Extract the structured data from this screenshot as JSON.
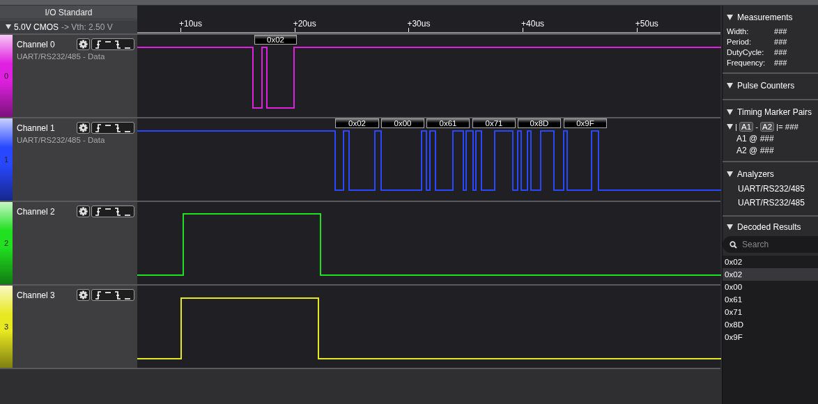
{
  "io_standard": {
    "title": "I/O Standard",
    "value": "5.0V CMOS",
    "threshold": "-> Vth: 2.50 V"
  },
  "timeline": {
    "ticks": [
      "+10us",
      "+20us",
      "+30us",
      "+40us",
      "+50us"
    ]
  },
  "channels": [
    {
      "name": "Channel 0",
      "number": "0",
      "analyzer": "UART/RS232/485 - Data",
      "color": "#e020e0",
      "decoded": [
        "0x02"
      ]
    },
    {
      "name": "Channel 1",
      "number": "1",
      "analyzer": "UART/RS232/485 - Data",
      "color": "#2848ff",
      "decoded": [
        "0x02",
        "0x00",
        "0x61",
        "0x71",
        "0x8D",
        "0x9F"
      ]
    },
    {
      "name": "Channel 2",
      "number": "2",
      "color": "#20e020"
    },
    {
      "name": "Channel 3",
      "number": "3",
      "color": "#e8e820"
    }
  ],
  "sidebar": {
    "measurements": {
      "title": "Measurements",
      "rows": [
        {
          "label": "Width:",
          "value": "###"
        },
        {
          "label": "Period:",
          "value": "###"
        },
        {
          "label": "DutyCycle:",
          "value": "###"
        },
        {
          "label": "Frequency:",
          "value": "###"
        }
      ]
    },
    "pulse_counters": {
      "title": "Pulse Counters"
    },
    "timing_marker_pairs": {
      "title": "Timing Marker Pairs",
      "pair": {
        "open": "|",
        "a": "A1",
        "separator": "-",
        "b": "A2",
        "close": "|=",
        "result": "###"
      },
      "markers": [
        "A1 @ ###",
        "A2 @ ###"
      ]
    },
    "analyzers": {
      "title": "Analyzers",
      "items": [
        "UART/RS232/485",
        "UART/RS232/485"
      ]
    },
    "decoded_results": {
      "title": "Decoded Results",
      "search_placeholder": "Search",
      "results": [
        {
          "value": "0x02",
          "selected": false
        },
        {
          "value": "0x02",
          "selected": true
        },
        {
          "value": "0x00",
          "selected": false
        },
        {
          "value": "0x61",
          "selected": false
        },
        {
          "value": "0x71",
          "selected": false
        },
        {
          "value": "0x8D",
          "selected": false
        },
        {
          "value": "0x9F",
          "selected": false
        }
      ]
    }
  }
}
